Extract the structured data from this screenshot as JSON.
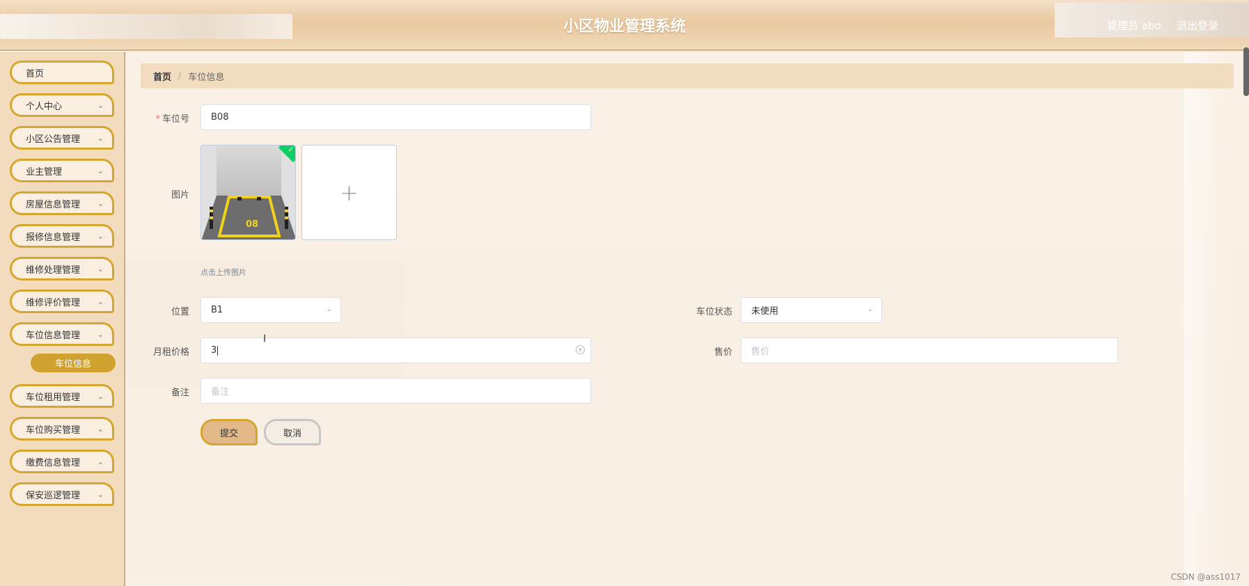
{
  "header": {
    "title": "小区物业管理系统",
    "user": "管理员 abo",
    "logout": "退出登录"
  },
  "sidebar": {
    "items": [
      {
        "label": "首页",
        "has_arrow": false
      },
      {
        "label": "个人中心",
        "has_arrow": true
      },
      {
        "label": "小区公告管理",
        "has_arrow": true
      },
      {
        "label": "业主管理",
        "has_arrow": true
      },
      {
        "label": "房屋信息管理",
        "has_arrow": true
      },
      {
        "label": "报修信息管理",
        "has_arrow": true
      },
      {
        "label": "维修处理管理",
        "has_arrow": true
      },
      {
        "label": "维修评价管理",
        "has_arrow": true
      },
      {
        "label": "车位信息管理",
        "has_arrow": true
      },
      {
        "label": "车位租用管理",
        "has_arrow": true
      },
      {
        "label": "车位购买管理",
        "has_arrow": true
      },
      {
        "label": "缴费信息管理",
        "has_arrow": true
      },
      {
        "label": "保安巡逻管理",
        "has_arrow": true
      }
    ],
    "active_sub": "车位信息"
  },
  "breadcrumb": {
    "home": "首页",
    "separator": "/",
    "current": "车位信息"
  },
  "form": {
    "space_no": {
      "label": "车位号",
      "required_mark": "*",
      "value": "B08"
    },
    "image": {
      "label": "图片",
      "thumb_text": "08",
      "tip": "点击上传图片",
      "add_symbol": "+"
    },
    "location": {
      "label": "位置",
      "value": "B1"
    },
    "status": {
      "label": "车位状态",
      "value": "未使用"
    },
    "rent": {
      "label": "月租价格",
      "value": "3"
    },
    "price": {
      "label": "售价",
      "placeholder": "售价"
    },
    "remark": {
      "label": "备注",
      "placeholder": "备注"
    },
    "submit": "提交",
    "cancel": "取消"
  },
  "watermark": "CSDN @ass1017",
  "colors": {
    "accent_gold": "#d4a62e",
    "active_submenu": "#cfa22f",
    "success_badge": "#13ce66"
  }
}
